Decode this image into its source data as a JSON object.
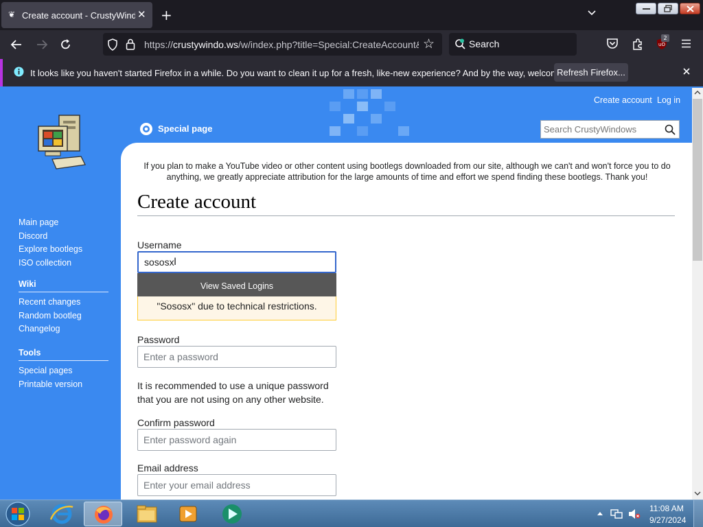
{
  "browser": {
    "tab_title": "Create account - CrustyWindows",
    "url_host": "crustywindo.ws",
    "url_prefix": "https://",
    "url_path": "/w/index.php?title=Special:CreateAccount&",
    "search_placeholder": "Search",
    "extension_badge": "2",
    "notification": "It looks like you haven't started Firefox in a while. Do you want to clean it up for a fresh, like-new experience? And by the way, welcome back!",
    "refresh_button": "Refresh Firefox..."
  },
  "wiki": {
    "header_links": {
      "create_account": "Create account",
      "log_in": "Log in"
    },
    "special_page_label": "Special page",
    "search_placeholder": "Search CrustyWindows",
    "sidebar": {
      "nav": [
        "Main page",
        "Discord",
        "Explore bootlegs",
        "ISO collection"
      ],
      "wiki_heading": "Wiki",
      "wiki_links": [
        "Recent changes",
        "Random bootleg",
        "Changelog"
      ],
      "tools_heading": "Tools",
      "tools_links": [
        "Special pages",
        "Printable version"
      ]
    },
    "notice": "If you plan to make a YouTube video or other content using bootlegs downloaded from our site, although we can't and won't force you to do anything, we greatly appreciate attribution for the large amounts of time and effort we spend finding these bootlegs. Thank you!",
    "page_title": "Create account",
    "form": {
      "username_label": "Username",
      "username_value": "sososx",
      "saved_logins": "View Saved Logins",
      "warning_text": "\"Sososx\" due to technical restrictions.",
      "password_label": "Password",
      "password_placeholder": "Enter a password",
      "password_hint": "It is recommended to use a unique password that you are not using on any other website.",
      "confirm_label": "Confirm password",
      "confirm_placeholder": "Enter password again",
      "email_label": "Email address",
      "email_placeholder": "Enter your email address"
    }
  },
  "taskbar": {
    "time": "11:08 AM",
    "date": "9/27/2024"
  },
  "colors": {
    "accent_purple": "#b833e1",
    "wiki_blue": "#3a89f0"
  }
}
